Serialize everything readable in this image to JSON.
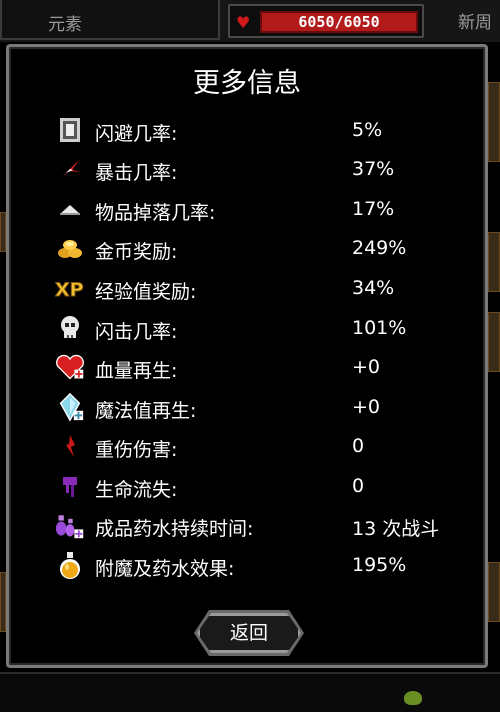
{
  "background": {
    "tab_left_label": "元素",
    "hp_text": "6050/6050",
    "tab_right_label": "新周"
  },
  "modal": {
    "title": "更多信息",
    "stats": [
      {
        "icon": "dodge-shield-icon",
        "label": "闪避几率:",
        "value": "5%"
      },
      {
        "icon": "crit-spark-icon",
        "label": "暴击几率:",
        "value": "37%"
      },
      {
        "icon": "item-pile-icon",
        "label": "物品掉落几率:",
        "value": "17%"
      },
      {
        "icon": "gold-coins-icon",
        "label": "金币奖励:",
        "value": "249%"
      },
      {
        "icon": "xp-icon",
        "label": "经验值奖励:",
        "value": "34%"
      },
      {
        "icon": "skull-icon",
        "label": "闪击几率:",
        "value": "101%"
      },
      {
        "icon": "heart-plus-icon",
        "label": "血量再生:",
        "value": "+0"
      },
      {
        "icon": "mana-crystal-plus-icon",
        "label": "魔法值再生:",
        "value": "+0"
      },
      {
        "icon": "blood-drop-icon",
        "label": "重伤伤害:",
        "value": "0"
      },
      {
        "icon": "poison-drip-icon",
        "label": "生命流失:",
        "value": "0"
      },
      {
        "icon": "potion-pair-plus-icon",
        "label": "成品药水持续时间:",
        "value": "13 次战斗"
      },
      {
        "icon": "potion-flask-icon",
        "label": "附魔及药水效果:",
        "value": "195%"
      }
    ],
    "back_label": "返回"
  },
  "colors": {
    "hp_bar": "#b31a1a",
    "modal_border": "#7a7a7a"
  }
}
